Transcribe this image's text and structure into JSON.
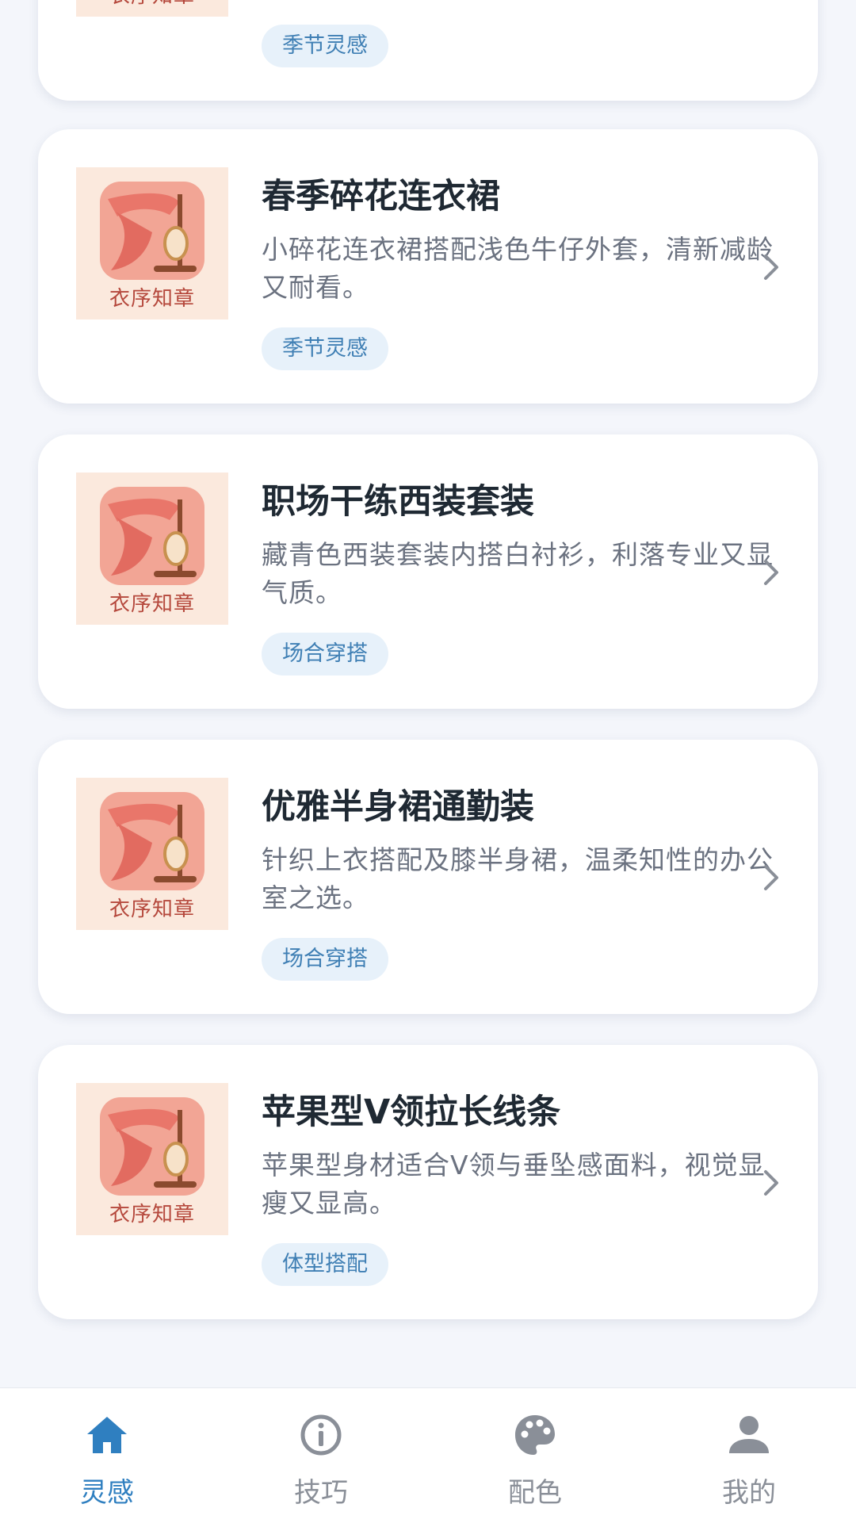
{
  "colors": {
    "accent": "#2f7fc0",
    "tag_bg": "#e7f1fa",
    "tag_text": "#3f7fb4",
    "inactive": "#8a8f98"
  },
  "cards": [
    {
      "title": "",
      "desc": "",
      "tag": "季节灵感",
      "thumb_caption": "衣序知章"
    },
    {
      "title": "春季碎花连衣裙",
      "desc": "小碎花连衣裙搭配浅色牛仔外套，清新减龄又耐看。",
      "tag": "季节灵感",
      "thumb_caption": "衣序知章"
    },
    {
      "title": "职场干练西装套装",
      "desc": "藏青色西装套装内搭白衬衫，利落专业又显气质。",
      "tag": "场合穿搭",
      "thumb_caption": "衣序知章"
    },
    {
      "title": "优雅半身裙通勤装",
      "desc": "针织上衣搭配及膝半身裙，温柔知性的办公室之选。",
      "tag": "场合穿搭",
      "thumb_caption": "衣序知章"
    },
    {
      "title": "苹果型V领拉长线条",
      "desc": "苹果型身材适合V领与垂坠感面料，视觉显瘦又显高。",
      "tag": "体型搭配",
      "thumb_caption": "衣序知章"
    }
  ],
  "nav": [
    {
      "label": "灵感",
      "icon": "home-icon",
      "active": true
    },
    {
      "label": "技巧",
      "icon": "info-icon",
      "active": false
    },
    {
      "label": "配色",
      "icon": "palette-icon",
      "active": false
    },
    {
      "label": "我的",
      "icon": "person-icon",
      "active": false
    }
  ]
}
